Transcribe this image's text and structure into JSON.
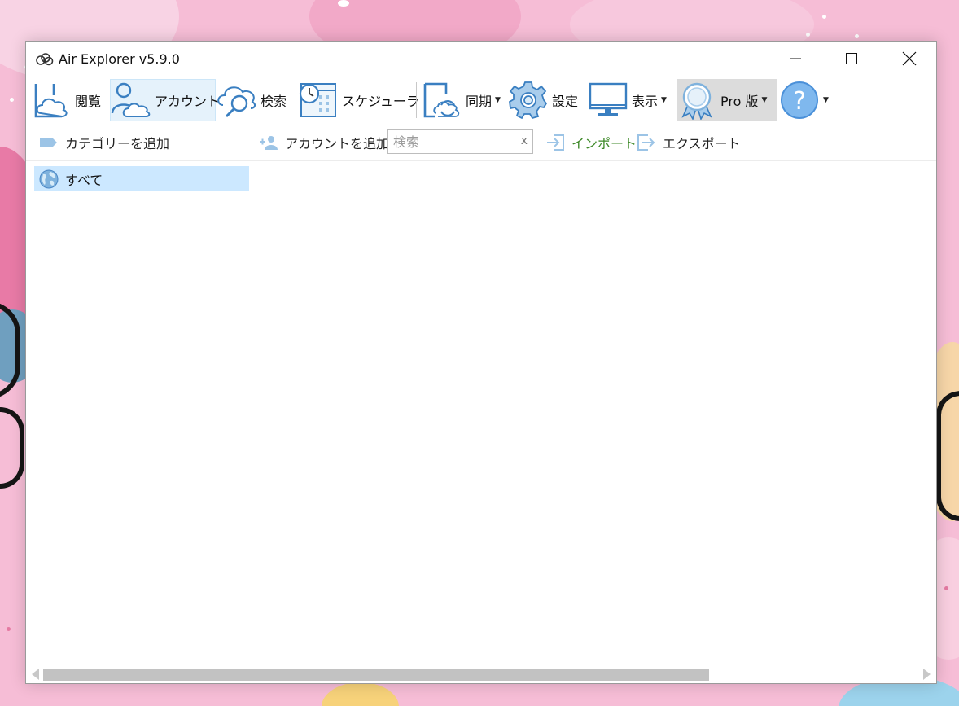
{
  "window": {
    "title": "Air Explorer v5.9.0"
  },
  "ribbon": {
    "items": [
      {
        "id": "browse",
        "label": "閲覧",
        "icon": "cloud-browse-icon"
      },
      {
        "id": "account",
        "label": "アカウント",
        "icon": "account-icon",
        "active": true
      },
      {
        "id": "search",
        "label": "検索",
        "icon": "cloud-search-icon"
      },
      {
        "id": "scheduler",
        "label": "スケジューラ",
        "icon": "scheduler-clock-icon"
      },
      {
        "id": "sync",
        "label": "同期",
        "icon": "sync-icon",
        "dropdown": true
      },
      {
        "id": "settings",
        "label": "設定",
        "icon": "gear-icon"
      },
      {
        "id": "view",
        "label": "表示",
        "icon": "monitor-icon",
        "dropdown": true
      },
      {
        "id": "pro",
        "label": "Pro 版",
        "icon": "award-badge-icon",
        "dropdown": true
      },
      {
        "id": "help",
        "label": "",
        "icon": "help-icon",
        "dropdown": true
      }
    ]
  },
  "toolbar": {
    "add_category": "カテゴリーを追加",
    "add_account": "アカウントを追加",
    "search_placeholder": "検索",
    "search_clear": "x",
    "import": "インポート",
    "export": "エクスポート"
  },
  "categories": [
    {
      "label": "すべて",
      "icon": "globe-icon",
      "selected": true
    }
  ],
  "colors": {
    "accent_blue": "#4a90d9",
    "selection": "#cce8ff",
    "green": "#5aa02c"
  }
}
